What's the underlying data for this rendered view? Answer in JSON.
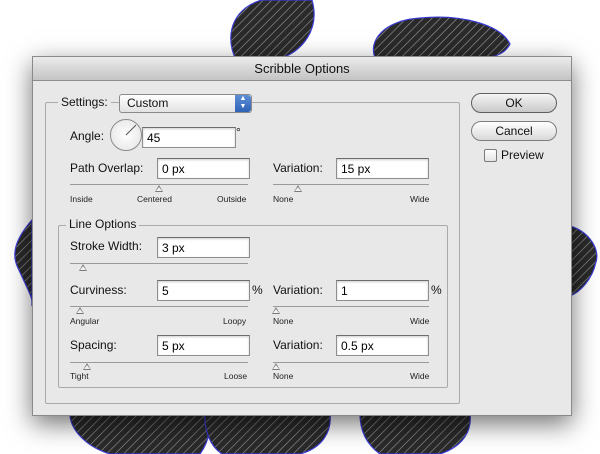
{
  "dialog": {
    "title": "Scribble Options"
  },
  "settings": {
    "label": "Settings:",
    "value": "Custom"
  },
  "angle": {
    "label": "Angle:",
    "value": "45",
    "unit": "°"
  },
  "path_overlap": {
    "label": "Path Overlap:",
    "value": "0 px",
    "slider": {
      "left": "Inside",
      "center": "Centered",
      "right": "Outside",
      "position": 0.5
    },
    "variation": {
      "label": "Variation:",
      "value": "15 px",
      "slider": {
        "left": "None",
        "right": "Wide",
        "position": 0.15
      }
    }
  },
  "line_options": {
    "title": "Line Options",
    "stroke_width": {
      "label": "Stroke Width:",
      "value": "3 px",
      "slider": {
        "position": 0.06
      }
    },
    "curviness": {
      "label": "Curviness:",
      "value": "5",
      "unit": "%",
      "slider": {
        "left": "Angular",
        "right": "Loopy",
        "position": 0.05
      },
      "variation": {
        "label": "Variation:",
        "value": "1",
        "unit": "%",
        "slider": {
          "left": "None",
          "right": "Wide",
          "position": 0.01
        }
      }
    },
    "spacing": {
      "label": "Spacing:",
      "value": "5 px",
      "slider": {
        "left": "Tight",
        "right": "Loose",
        "position": 0.09
      },
      "variation": {
        "label": "Variation:",
        "value": "0.5 px",
        "slider": {
          "left": "None",
          "right": "Wide",
          "position": 0.01
        }
      }
    }
  },
  "buttons": {
    "ok": "OK",
    "cancel": "Cancel",
    "preview": "Preview",
    "preview_checked": false
  },
  "icons": {
    "select_arrows": "up-down-arrows-icon",
    "pointer": "mouse-pointer-icon"
  },
  "colors": {
    "scribble_fill": "#1a1a1a",
    "artwork_outline": "#3b3bd6",
    "select_accent": "#3a6fc4"
  }
}
